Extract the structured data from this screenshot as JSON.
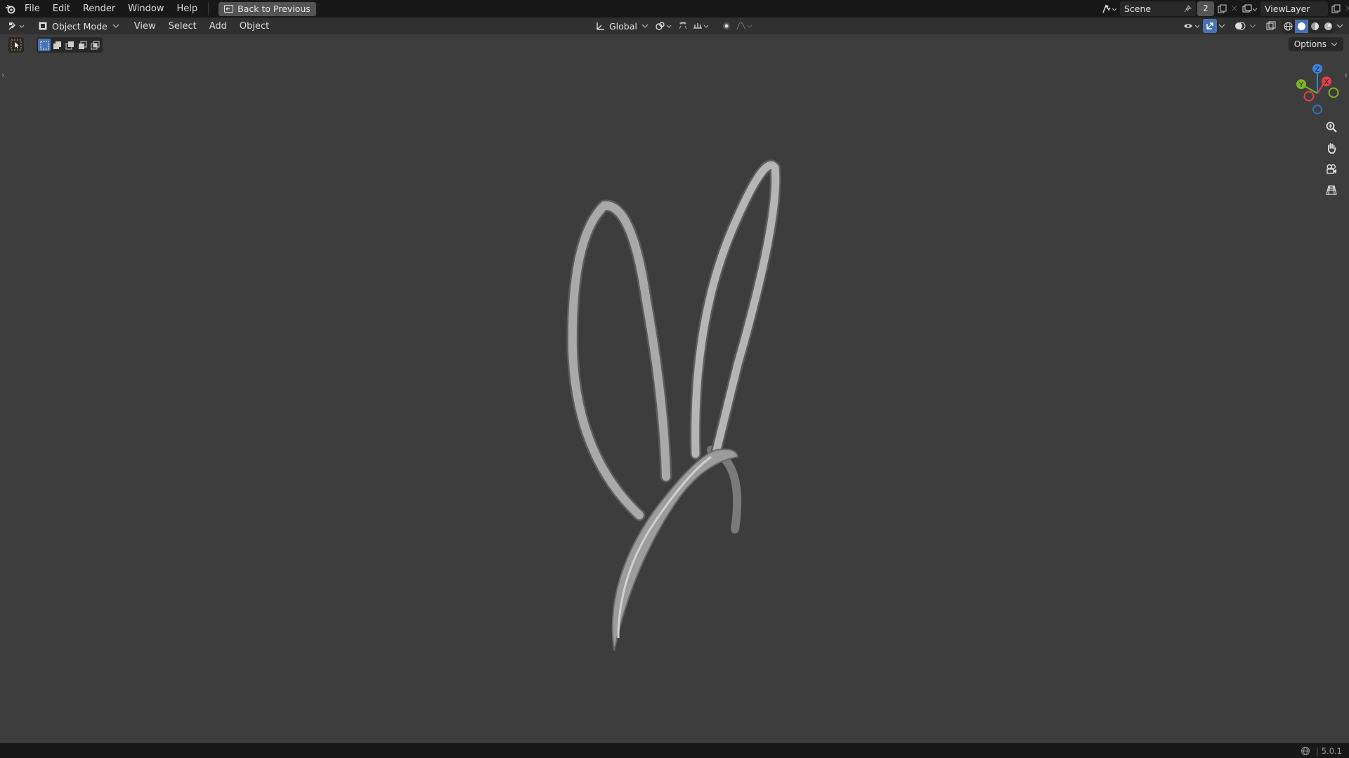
{
  "topbar": {
    "menus": [
      "File",
      "Edit",
      "Render",
      "Window",
      "Help"
    ],
    "back_label": "Back to Previous",
    "scene_name": "Scene",
    "scene_users": "2",
    "view_layer": "ViewLayer"
  },
  "header": {
    "mode": "Object Mode",
    "menus": [
      "View",
      "Select",
      "Add",
      "Object"
    ],
    "transform_orientation": "Global"
  },
  "viewport": {
    "options_label": "Options",
    "gizmo_axes": {
      "z": "Z",
      "y": "Y",
      "x": "X"
    }
  },
  "status": {
    "version": "5.0.1"
  },
  "colors": {
    "accent": "#4772b3",
    "axis_x": "#e0414e",
    "axis_y": "#7fb321",
    "axis_z": "#3b84d8",
    "background": "#3d3d3d"
  }
}
